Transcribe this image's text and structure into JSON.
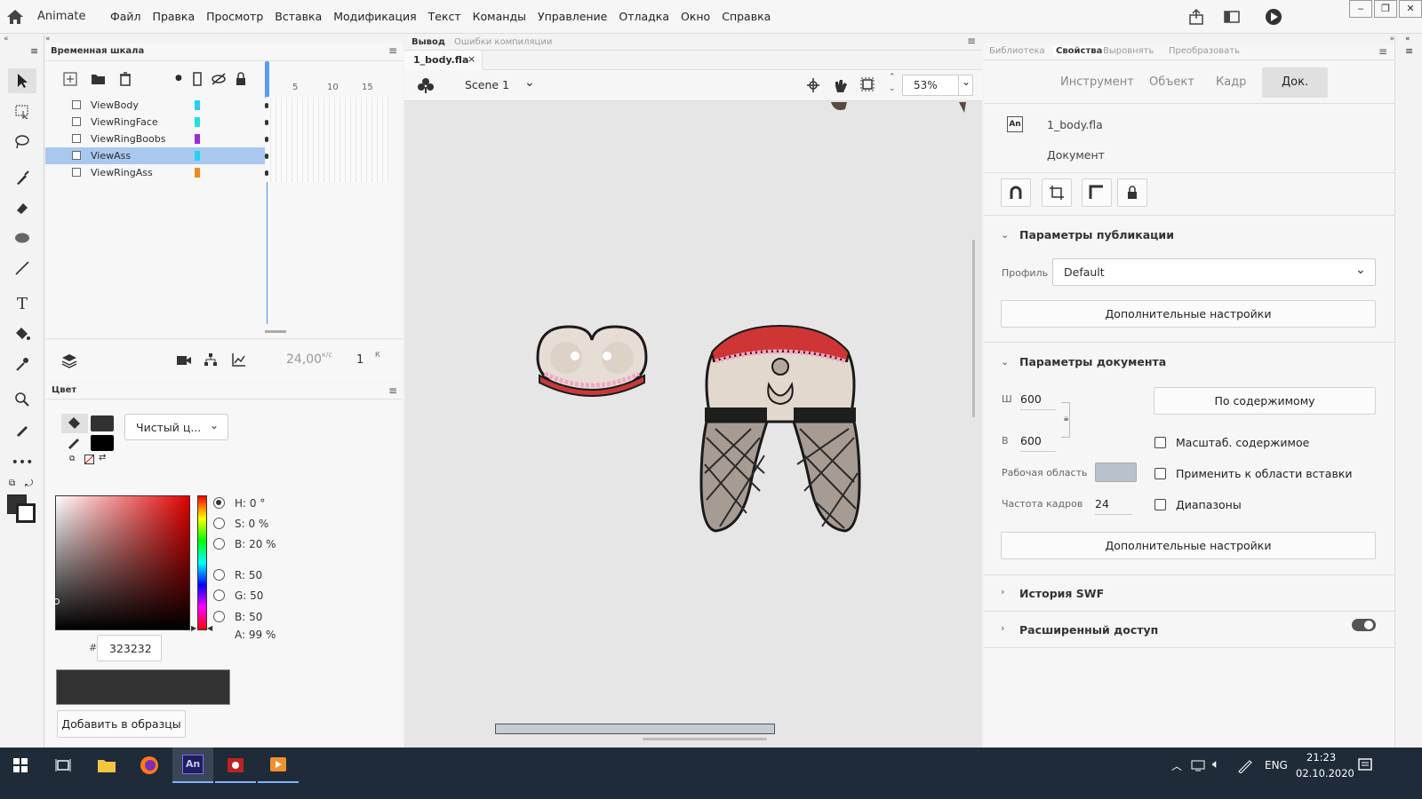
{
  "app": {
    "name": "Animate"
  },
  "menu": [
    "Файл",
    "Правка",
    "Просмотр",
    "Вставка",
    "Модификация",
    "Текст",
    "Команды",
    "Управление",
    "Отладка",
    "Окно",
    "Справка"
  ],
  "window_buttons": [
    "‒",
    "❐",
    "✕"
  ],
  "timeline": {
    "tab": "Временная шкала",
    "layers": [
      {
        "name": "ViewBody",
        "color": "#21d0f0",
        "selected": false
      },
      {
        "name": "ViewRingFace",
        "color": "#21e0e0",
        "selected": false
      },
      {
        "name": "ViewRingBoobs",
        "color": "#9b2cd6",
        "selected": false
      },
      {
        "name": "ViewAss",
        "color": "#22d4f0",
        "selected": true
      },
      {
        "name": "ViewRingAss",
        "color": "#f08a22",
        "selected": false
      }
    ],
    "frame_ticks": [
      "5",
      "10",
      "15"
    ],
    "fps": "24,00",
    "fps_unit": "к/с",
    "frame": "1",
    "frame_unit": "К"
  },
  "color": {
    "tab": "Цвет",
    "fill_type": "Чистый ц...",
    "H": "H:  0 °",
    "S": "S:  0 %",
    "B": "B:  20 %",
    "R": "R:  50",
    "G": "G:  50",
    "Bv": "B:  50",
    "A": "A:  99 %",
    "hex_label": "#",
    "hex": "323232",
    "add_swatch": "Добавить в образцы",
    "current": "#323232"
  },
  "stage": {
    "tab_output": "Вывод",
    "tab_errors": "Ошибки компиляции",
    "doc_tab": "1_body.fla",
    "scene": "Scene 1",
    "zoom": "53%"
  },
  "props": {
    "tabs": [
      "Библиотека",
      "Свойства",
      "Выровнять",
      "Преобразовать"
    ],
    "subtabs": [
      "Инструмент",
      "Объект",
      "Кадр",
      "Док."
    ],
    "doc_name": "1_body.fla",
    "doc_label": "Документ",
    "publish_section": "Параметры публикации",
    "profile_label": "Профиль",
    "profile_value": "Default",
    "more_settings": "Дополнительные настройки",
    "doc_section": "Параметры документа",
    "w_label": "Ш",
    "w_value": "600",
    "h_label": "В",
    "h_value": "600",
    "fit_content": "По содержимому",
    "scale_content": "Масштаб. содержимое",
    "apply_paste": "Применить к области вставки",
    "ranges": "Диапазоны",
    "stage_label": "Рабочая область",
    "stage_color": "#b8c2cc",
    "fps_label": "Частота кадров",
    "fps_value": "24",
    "more_settings2": "Дополнительные настройки",
    "swf_history": "История SWF",
    "advanced_access": "Расширенный доступ"
  },
  "taskbar": {
    "lang": "ENG",
    "time": "21:23",
    "date": "02.10.2020"
  }
}
